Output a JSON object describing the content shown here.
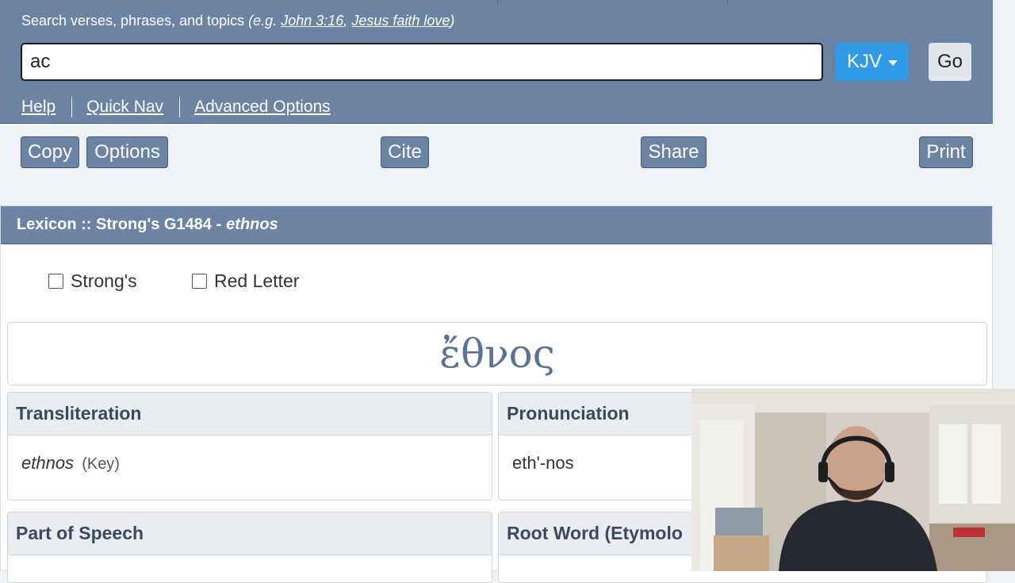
{
  "search": {
    "hint_prefix": "Search verses, phrases, and topics",
    "hint_eg": "(e.g.",
    "example1": "John 3:16",
    "comma": ",",
    "example2": "Jesus faith love",
    "hint_close": ")",
    "value": "ac",
    "version": "KJV",
    "go": "Go"
  },
  "links": {
    "help": "Help",
    "quick_nav": "Quick Nav",
    "advanced": "Advanced Options"
  },
  "toolbar": {
    "copy": "Copy",
    "options": "Options",
    "cite": "Cite",
    "share": "Share",
    "print": "Print"
  },
  "lexicon": {
    "title_prefix": "Lexicon :: Strong's G1484 -",
    "title_word": "ethnos",
    "checkbox_strongs": "Strong's",
    "checkbox_red_letter": "Red Letter",
    "greek_word": "ἔθνος",
    "transliteration_label": "Transliteration",
    "transliteration_value": "ethnos",
    "transliteration_key": "(Key)",
    "pronunciation_label": "Pronunciation",
    "pronunciation_value": "eth'-nos",
    "part_of_speech_label": "Part of Speech",
    "root_word_label": "Root Word (Etymolo"
  },
  "colors": {
    "panel": "#6b84a4",
    "version_button": "#2f9be6",
    "greek_text": "#5b7295"
  }
}
